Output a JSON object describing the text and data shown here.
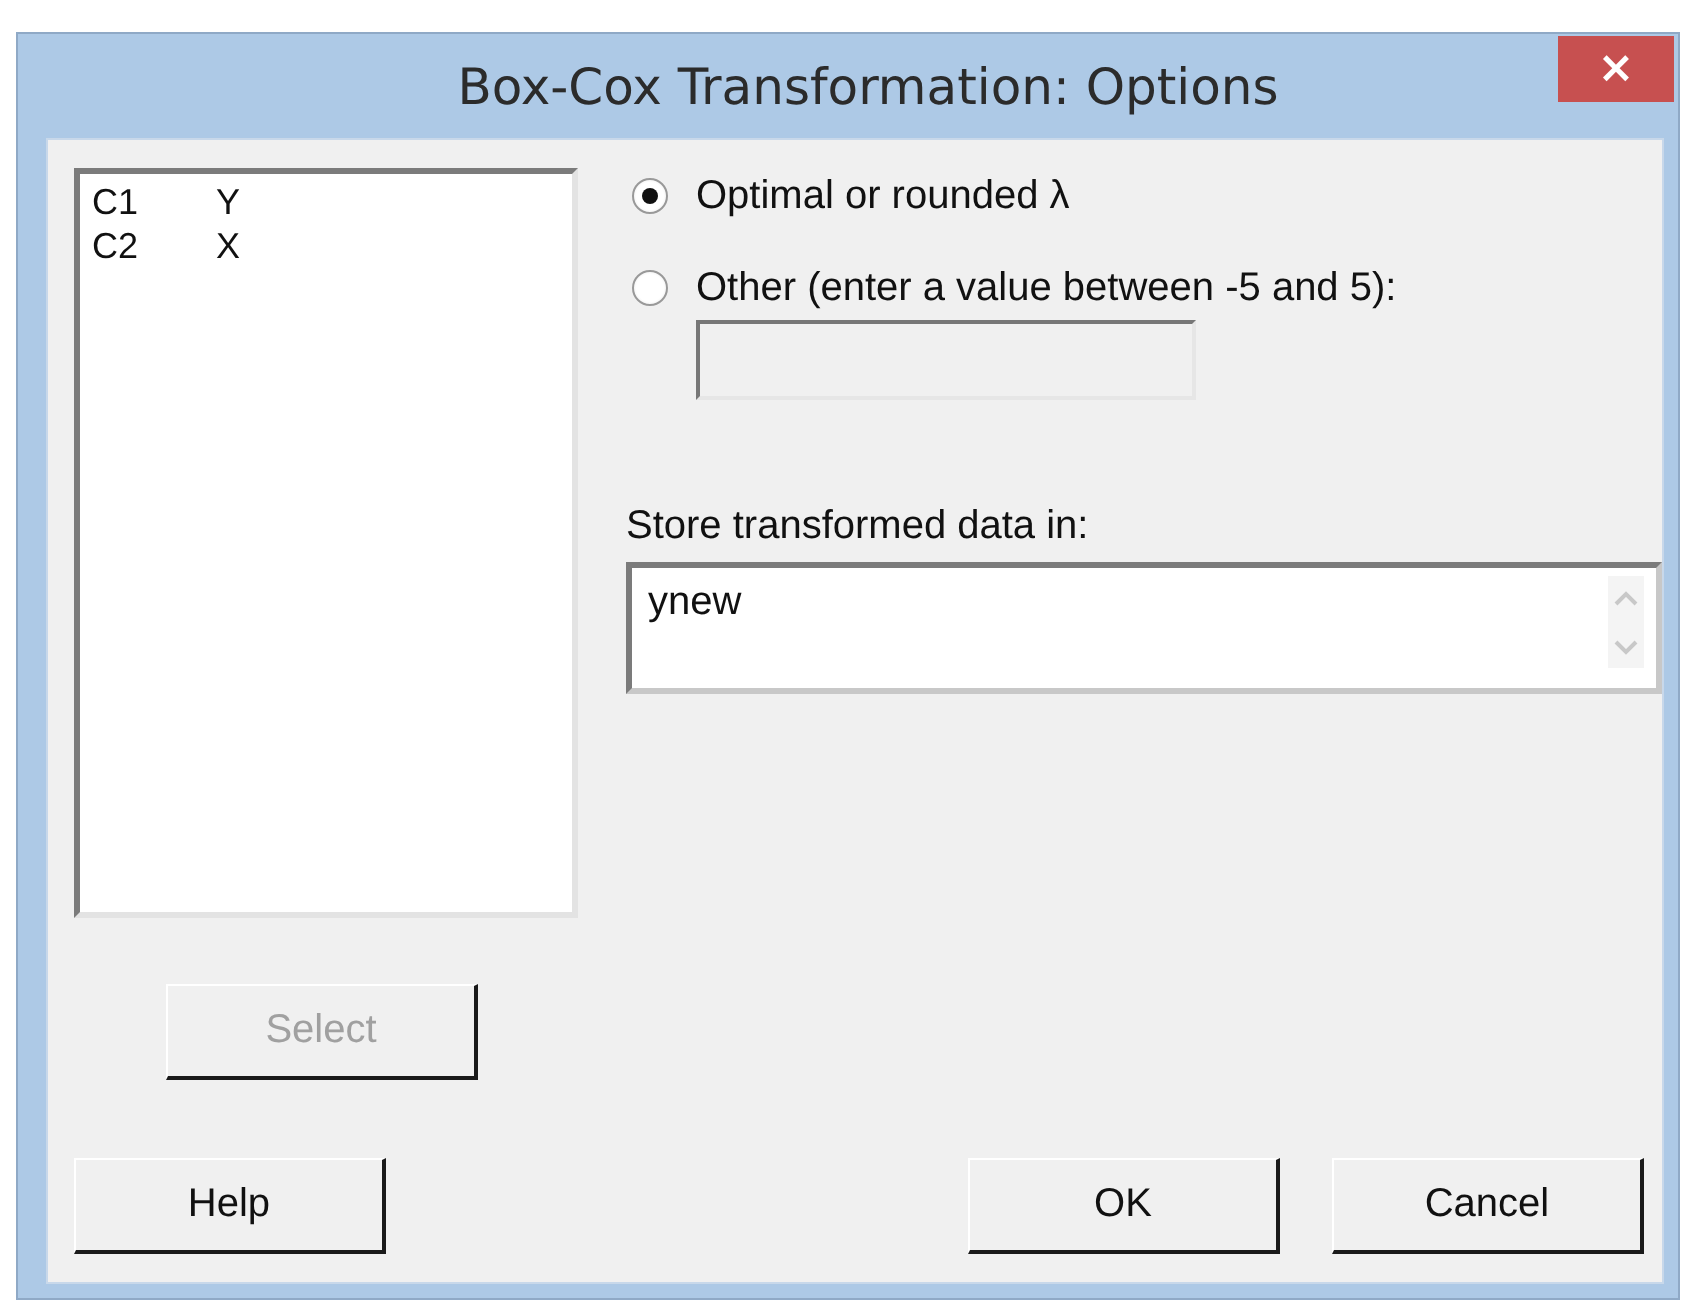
{
  "window": {
    "title": "Box-Cox Transformation: Options",
    "close": "×"
  },
  "variables": [
    {
      "column": "C1",
      "name": "Y"
    },
    {
      "column": "C2",
      "name": "X"
    }
  ],
  "select_button": {
    "label": "Select",
    "disabled": true
  },
  "lambda_options": [
    {
      "label": "Optimal or rounded λ",
      "selected": true
    },
    {
      "label": "Other (enter a value between -5 and 5):",
      "selected": false
    }
  ],
  "other_value": {
    "disabled": true
  },
  "store": {
    "label": "Store transformed data in:",
    "value": "ynew"
  },
  "buttons": [
    {
      "label": "Help",
      "kind": "left"
    },
    {
      "label": "OK",
      "kind": "right"
    },
    {
      "label": "Cancel",
      "kind": "right"
    }
  ]
}
